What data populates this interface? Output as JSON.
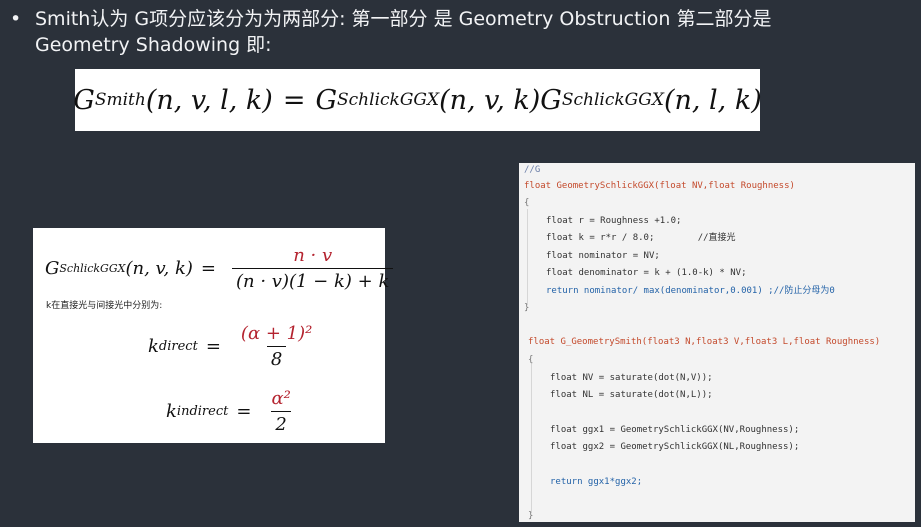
{
  "bullet": {
    "dot": "•",
    "line1": "Smith认为 G项分应该分为为两部分: 第一部分 是 Geometry Obstruction 第二部分是",
    "line2": "Geometry Shadowing 即:"
  },
  "formula_top": {
    "G": "G",
    "smith_sub": "Smith",
    "args1": "(n, v, l, k)",
    "eq": "=",
    "ggx_sub": "SchlickGGX",
    "args2": "(n, v, k)",
    "args3": "(n, l, k)"
  },
  "formula_left": {
    "G": "G",
    "ggx_sub": "SchlickGGX",
    "args": "(n, v, k)",
    "eq": "=",
    "numerator": "n · v",
    "denominator": "(n · v)(1 − k) + k",
    "note": "k在直接光与间接光中分别为:",
    "k": "k",
    "direct_sub": "direct",
    "direct_num": "(α + 1)²",
    "direct_den": "8",
    "indirect_sub": "indirect",
    "indirect_num": "α²",
    "indirect_den": "2"
  },
  "code": {
    "lines": [
      "//G",
      "float GeometrySchlickGGX(float NV,float Roughness)",
      "{",
      "float r = Roughness +1.0;",
      "float k = r*r / 8.0;        //直接光",
      "float nominator = NV;",
      "float denominator = k + (1.0-k) * NV;",
      "return nominator/ max(denominator,0.001) ;//防止分母为0",
      "}",
      "float G_GeometrySmith(float3 N,float3 V,float3 L,float Roughness)",
      "{",
      "float NV = saturate(dot(N,V));",
      "float NL = saturate(dot(N,L));",
      "float ggx1 = GeometrySchlickGGX(NV,Roughness);",
      "float ggx2 = GeometrySchlickGGX(NL,Roughness);",
      "return ggx1*ggx2;",
      "}"
    ]
  }
}
